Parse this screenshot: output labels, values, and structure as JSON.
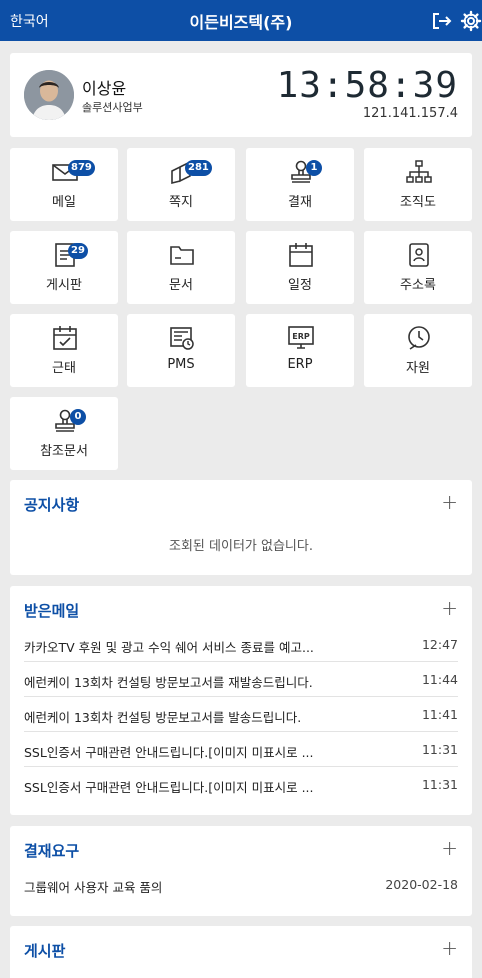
{
  "topbar": {
    "language": "한국어",
    "company": "이든비즈텍(주)"
  },
  "profile": {
    "name": "이상윤",
    "department": "솔루션사업부",
    "clock": "13:58:39",
    "ip": "121.141.157.4"
  },
  "tiles": [
    {
      "label": "메일",
      "badge": "879"
    },
    {
      "label": "쪽지",
      "badge": "281"
    },
    {
      "label": "결재",
      "badge": "1"
    },
    {
      "label": "조직도"
    },
    {
      "label": "게시판",
      "badge": "29"
    },
    {
      "label": "문서"
    },
    {
      "label": "일정"
    },
    {
      "label": "주소록"
    },
    {
      "label": "근태"
    },
    {
      "label": "PMS"
    },
    {
      "label": "ERP"
    },
    {
      "label": "자원"
    },
    {
      "label": "참조문서",
      "badge": "0"
    }
  ],
  "notice": {
    "title": "공지사항",
    "add": "+",
    "empty": "조회된 데이터가 없습니다."
  },
  "mail": {
    "title": "받은메일",
    "add": "+",
    "items": [
      {
        "subject": "카카오TV 후원 및 광고 수익 쉐어 서비스 종료를 예고...",
        "time": "12:47"
      },
      {
        "subject": "에런케이 13회차 컨설팅 방문보고서를 재발송드립니다.",
        "time": "11:44"
      },
      {
        "subject": "에런케이 13회차 컨설팅 방문보고서를 발송드립니다.",
        "time": "11:41"
      },
      {
        "subject": "SSL인증서 구매관련 안내드립니다.[이미지 미표시로 ...",
        "time": "11:31"
      },
      {
        "subject": "SSL인증서 구매관련 안내드립니다.[이미지 미표시로 ...",
        "time": "11:31"
      }
    ]
  },
  "approval": {
    "title": "결재요구",
    "add": "+",
    "items": [
      {
        "subject": "그룹웨어 사용자 교육 품의",
        "date": "2020-02-18"
      }
    ]
  },
  "board": {
    "title": "게시판",
    "add": "+"
  }
}
